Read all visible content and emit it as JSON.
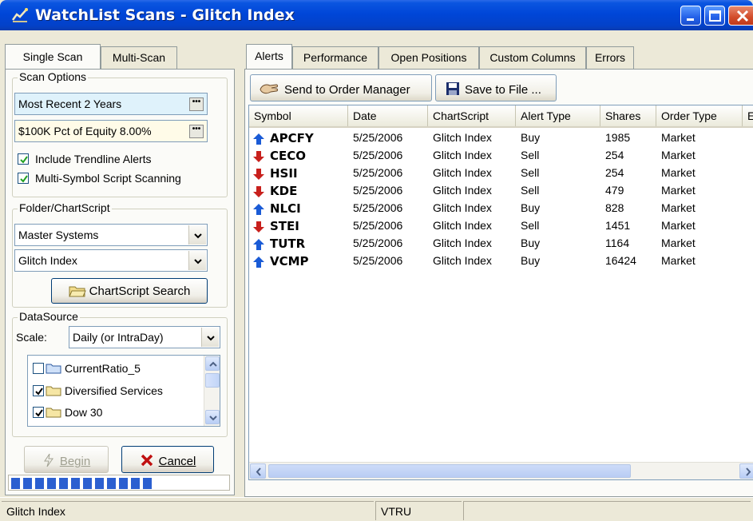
{
  "window": {
    "title": "WatchList Scans - Glitch Index"
  },
  "left_tabs": [
    {
      "label": "Single Scan"
    },
    {
      "label": "Multi-Scan"
    }
  ],
  "scan_options": {
    "group_label": "Scan Options",
    "range": "Most Recent 2 Years",
    "sizing": "$100K Pct of Equity 8.00%",
    "include_trendline": {
      "label": "Include Trendline Alerts",
      "checked": true
    },
    "multi_symbol": {
      "label": "Multi-Symbol Script Scanning",
      "checked": true
    }
  },
  "folder_chartscript": {
    "group_label": "Folder/ChartScript",
    "folder": "Master Systems",
    "chartscript": "Glitch Index",
    "search_button": "ChartScript Search"
  },
  "datasource": {
    "group_label": "DataSource",
    "scale_label": "Scale:",
    "scale_value": "Daily (or IntraDay)",
    "items": [
      {
        "label": "CurrentRatio_5",
        "checked": false
      },
      {
        "label": "Diversified Services",
        "checked": true
      },
      {
        "label": "Dow 30",
        "checked": true
      }
    ]
  },
  "actions": {
    "begin": "Begin",
    "cancel": "Cancel"
  },
  "progress": {
    "blocks": 12
  },
  "right_tabs": [
    {
      "label": "Alerts"
    },
    {
      "label": "Performance"
    },
    {
      "label": "Open Positions"
    },
    {
      "label": "Custom Columns"
    },
    {
      "label": "Errors"
    }
  ],
  "toolbar": {
    "send": "Send to Order Manager",
    "save": "Save to File ..."
  },
  "grid": {
    "columns": [
      "Symbol",
      "Date",
      "ChartScript",
      "Alert Type",
      "Shares",
      "Order Type",
      "E"
    ],
    "rows": [
      {
        "symbol": "APCFY",
        "date": "5/25/2006",
        "chartscript": "Glitch Index",
        "alert_type": "Buy",
        "shares": "1985",
        "order_type": "Market",
        "direction": "up"
      },
      {
        "symbol": "CECO",
        "date": "5/25/2006",
        "chartscript": "Glitch Index",
        "alert_type": "Sell",
        "shares": "254",
        "order_type": "Market",
        "direction": "down"
      },
      {
        "symbol": "HSII",
        "date": "5/25/2006",
        "chartscript": "Glitch Index",
        "alert_type": "Sell",
        "shares": "254",
        "order_type": "Market",
        "direction": "down"
      },
      {
        "symbol": "KDE",
        "date": "5/25/2006",
        "chartscript": "Glitch Index",
        "alert_type": "Sell",
        "shares": "479",
        "order_type": "Market",
        "direction": "down"
      },
      {
        "symbol": "NLCI",
        "date": "5/25/2006",
        "chartscript": "Glitch Index",
        "alert_type": "Buy",
        "shares": "828",
        "order_type": "Market",
        "direction": "up"
      },
      {
        "symbol": "STEI",
        "date": "5/25/2006",
        "chartscript": "Glitch Index",
        "alert_type": "Sell",
        "shares": "1451",
        "order_type": "Market",
        "direction": "down"
      },
      {
        "symbol": "TUTR",
        "date": "5/25/2006",
        "chartscript": "Glitch Index",
        "alert_type": "Buy",
        "shares": "1164",
        "order_type": "Market",
        "direction": "up"
      },
      {
        "symbol": "VCMP",
        "date": "5/25/2006",
        "chartscript": "Glitch Index",
        "alert_type": "Buy",
        "shares": "16424",
        "order_type": "Market",
        "direction": "up"
      }
    ]
  },
  "statusbar": {
    "left": "Glitch Index",
    "middle": "VTRU",
    "right": ""
  },
  "colors": {
    "buy_arrow": "#1a5bd6",
    "sell_arrow": "#c8201c",
    "title_bar": "#0046d8",
    "progress": "#2b5fd0"
  },
  "icons": {
    "app": "chart-icon",
    "send": "hand-icon",
    "save": "floppy-icon",
    "search": "folder-open-icon",
    "begin": "lightning-icon",
    "cancel": "x-icon"
  }
}
